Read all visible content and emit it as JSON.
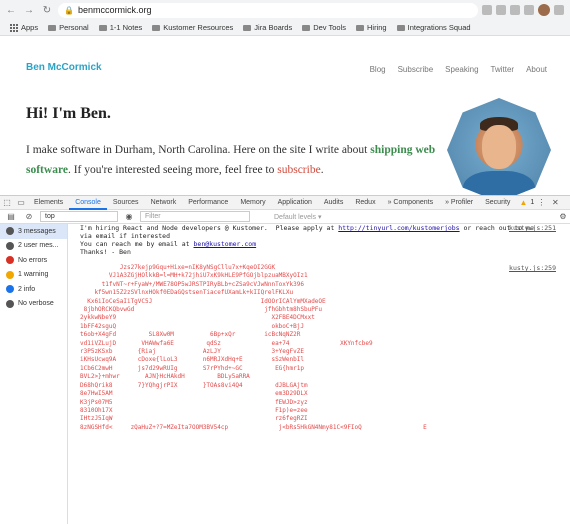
{
  "browser": {
    "url": "benmccormick.org",
    "bookmarks": [
      "Apps",
      "Personal",
      "1-1 Notes",
      "Kustomer Resources",
      "Jira Boards",
      "Dev Tools",
      "Hiring",
      "Integrations Squad"
    ]
  },
  "site": {
    "logo": "Ben McCormick",
    "nav": [
      "Blog",
      "Subscribe",
      "Speaking",
      "Twitter",
      "About"
    ],
    "heading": "Hi! I'm Ben.",
    "intro_part1": "I make software in Durham, North Carolina. Here on the site I write about ",
    "intro_link1": "shipping web software",
    "intro_part2": ". If you're interested seeing more, feel free to ",
    "intro_link2": "subscribe",
    "intro_part3": "."
  },
  "devtools": {
    "tabs": [
      "Elements",
      "Console",
      "Sources",
      "Network",
      "Performance",
      "Memory",
      "Application",
      "Audits",
      "Redux",
      "» Components",
      "» Profiler",
      "Security"
    ],
    "active_tab": "Console",
    "warning_count": "1",
    "context": "top",
    "filter_placeholder": "Filter",
    "levels": "Default levels ▾",
    "sidebar": [
      {
        "label": "3 messages",
        "color": "#555"
      },
      {
        "label": "2 user mes...",
        "color": "#555"
      },
      {
        "label": "No errors",
        "color": "#d93025"
      },
      {
        "label": "1 warning",
        "color": "#f2a600"
      },
      {
        "label": "2 info",
        "color": "#1a73e8"
      },
      {
        "label": "No verbose",
        "color": "#555"
      }
    ],
    "messages": [
      {
        "line1": "I'm hiring React and Node developers @ Kustomer.  Please apply at ",
        "link1": "http://tinyurl.com/kustomerjobs",
        "line1b": " or reach out to me",
        "line2": "via email if interested",
        "line3": "You can reach me by email at ",
        "link2": "ben@kustomer.com",
        "line4": "Thanks! - Ben",
        "source": "kusty.js:251"
      },
      {
        "source": "kusty.js:259"
      }
    ]
  }
}
